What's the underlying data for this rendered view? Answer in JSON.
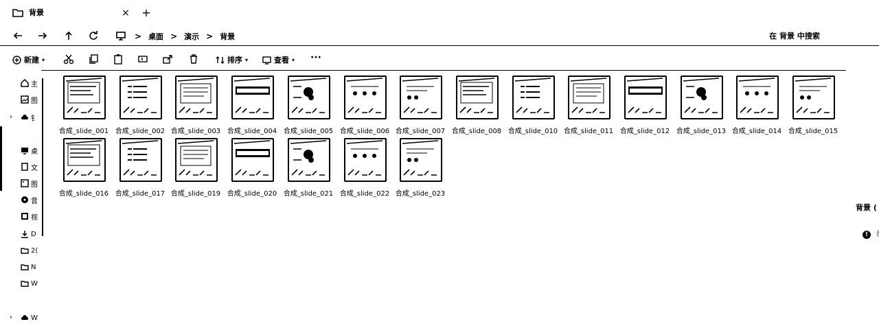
{
  "tab": {
    "title": "背景",
    "close": "×",
    "new_tab": "+"
  },
  "nav": {
    "breadcrumbs": [
      "桌面",
      "演示",
      "背景"
    ],
    "separator": ">",
    "search_placeholder": "在 背景 中搜索"
  },
  "toolbar": {
    "new_label": "新建",
    "sort_label": "排序",
    "view_label": "查看",
    "more_label": "···"
  },
  "sidebar": {
    "items": [
      {
        "label": "主",
        "icon": "home-icon"
      },
      {
        "label": "图",
        "icon": "gallery-icon"
      },
      {
        "label": "钅",
        "icon": "cloud-icon"
      },
      {
        "label": "桌",
        "icon": "desktop-icon"
      },
      {
        "label": "文",
        "icon": "document-icon"
      },
      {
        "label": "图",
        "icon": "pictures-icon"
      },
      {
        "label": "音",
        "icon": "music-icon"
      },
      {
        "label": "视",
        "icon": "video-icon"
      },
      {
        "label": "D",
        "icon": "download-icon"
      },
      {
        "label": "2(",
        "icon": "folder-icon"
      },
      {
        "label": "N",
        "icon": "folder-icon"
      },
      {
        "label": "W",
        "icon": "folder-icon"
      },
      {
        "label": "W",
        "icon": "cloud-icon"
      }
    ]
  },
  "files": [
    "合成_slide_001",
    "合成_slide_002",
    "合成_slide_003",
    "合成_slide_004",
    "合成_slide_005",
    "合成_slide_006",
    "合成_slide_007",
    "合成_slide_008",
    "合成_slide_010",
    "合成_slide_011",
    "合成_slide_012",
    "合成_slide_013",
    "合成_slide_014",
    "合成_slide_015",
    "合成_slide_016",
    "合成_slide_017",
    "合成_slide_019",
    "合成_slide_020",
    "合成_slide_021",
    "合成_slide_022",
    "合成_slide_023"
  ],
  "details": {
    "title": "背景 (",
    "info_icon": "!",
    "text": "示"
  }
}
